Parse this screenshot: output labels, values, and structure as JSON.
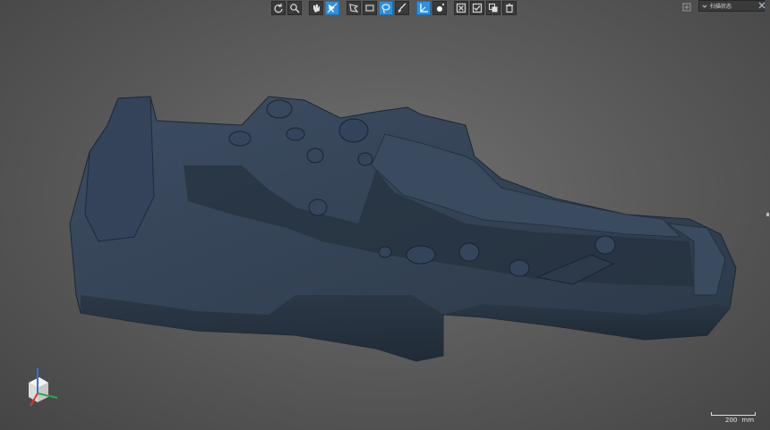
{
  "toolbar": {
    "buttons": [
      {
        "icon": "rotate-icon",
        "active": false
      },
      {
        "icon": "zoom-icon",
        "active": false
      },
      {
        "icon": "hand-select-icon",
        "active": false
      },
      {
        "icon": "cursor-select-icon",
        "active": true
      },
      {
        "icon": "polygon-select-icon",
        "active": false
      },
      {
        "icon": "rectangle-select-icon",
        "active": false
      },
      {
        "icon": "lasso-select-icon",
        "active": true
      },
      {
        "icon": "brush-icon",
        "active": false
      },
      {
        "icon": "axis-icon",
        "active": true
      },
      {
        "icon": "point-icon",
        "active": false
      },
      {
        "icon": "deselect-icon",
        "active": false
      },
      {
        "icon": "select-all-icon",
        "active": false
      },
      {
        "icon": "invert-selection-icon",
        "active": false
      },
      {
        "icon": "delete-icon",
        "active": false
      }
    ]
  },
  "panel": {
    "label": "扫描状态"
  },
  "scale": {
    "value": "200",
    "unit": "mm"
  },
  "colors": {
    "mesh": "#2f3d4f",
    "accent": "#2f8fdd"
  }
}
